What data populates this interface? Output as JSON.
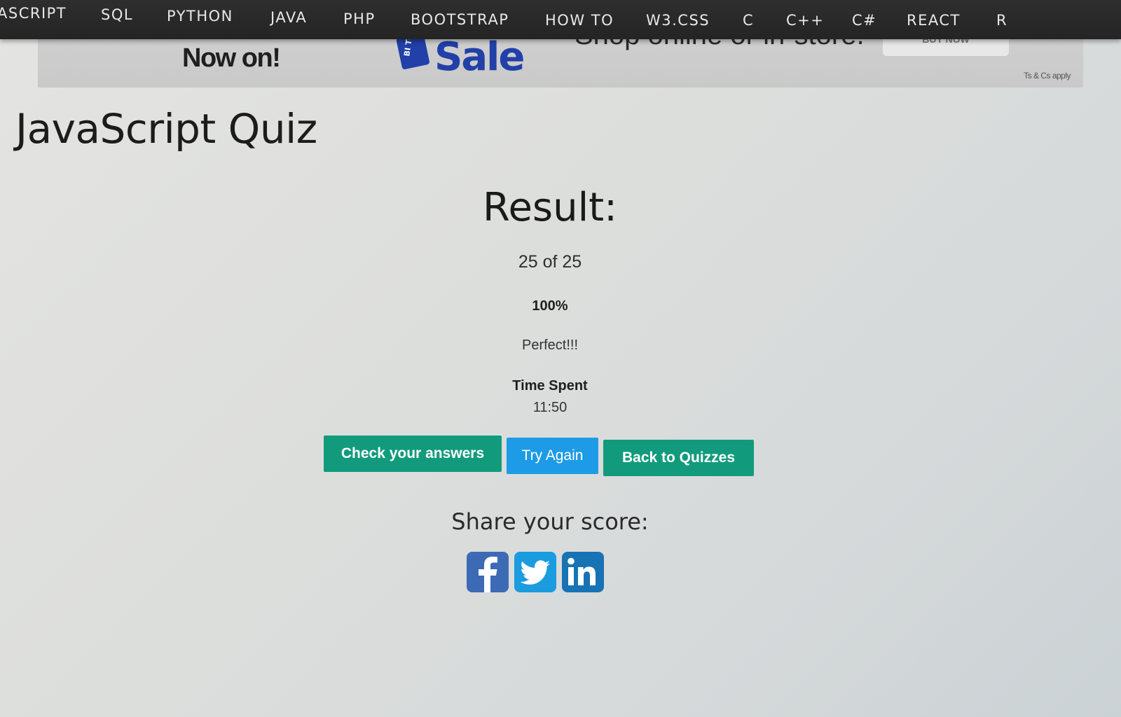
{
  "nav": {
    "items": [
      "ASCRIPT",
      "SQL",
      "PYTHON",
      "JAVA",
      "PHP",
      "BOOTSTRAP",
      "HOW TO",
      "W3.CSS",
      "C",
      "C++",
      "C#",
      "REACT",
      "R"
    ]
  },
  "ad": {
    "tagline": "Now on!",
    "logo_text": "Sale",
    "badge_text": "BI TO",
    "shop_text": "Shop online or in-store.",
    "cta_label": "BUY NOW",
    "terms": "Ts & Cs apply"
  },
  "page": {
    "title": "JavaScript Quiz"
  },
  "result": {
    "heading": "Result:",
    "score": "25 of 25",
    "percent": "100%",
    "message": "Perfect!!!",
    "time_label": "Time Spent",
    "time_value": "11:50"
  },
  "actions": {
    "check_label": "Check your answers",
    "try_label": "Try Again",
    "back_label": "Back to Quizzes"
  },
  "share": {
    "label": "Share your score:",
    "icons": [
      "facebook-icon",
      "twitter-icon",
      "linkedin-icon"
    ]
  },
  "colors": {
    "nav_bg": "#2a2a2a",
    "primary_green": "#119b7c",
    "try_blue": "#1d9be6",
    "facebook": "#3d6ab5",
    "twitter": "#1a9cdf",
    "linkedin": "#1873b5",
    "sale_blue": "#2140a8"
  }
}
